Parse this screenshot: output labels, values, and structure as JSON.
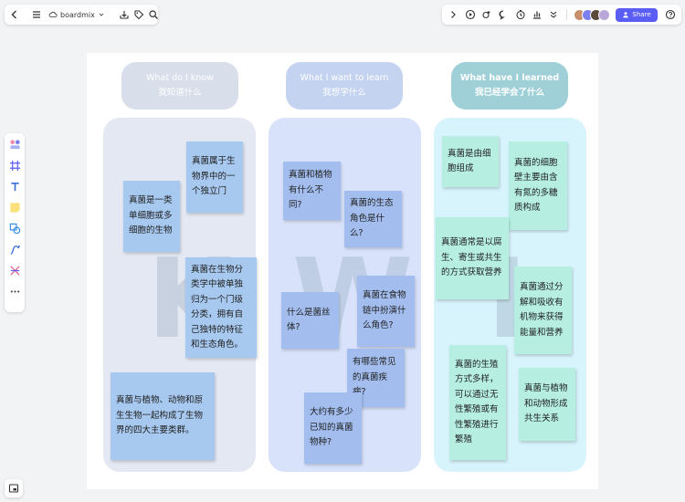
{
  "app": {
    "file_name": "boardmix",
    "share_label": "Share"
  },
  "icons": {
    "top_left": [
      "back-icon",
      "menu-icon",
      "cloud-icon",
      "chevron-down-icon",
      "download-icon",
      "tag-icon",
      "search-icon"
    ],
    "top_right": [
      "chevron-right-icon",
      "play-icon",
      "collaborate-icon",
      "comment-icon",
      "timer-icon",
      "chart-icon",
      "more-down-icon",
      "help-icon"
    ],
    "left_tools": [
      "template-icon",
      "frame-icon",
      "text-icon",
      "sticky-note-icon",
      "shape-icon",
      "pen-icon",
      "connector-icon",
      "more-icon"
    ]
  },
  "colors": {
    "accent": "#5b5ef4",
    "k_column": "#e3e8f3",
    "w_column": "#d8e3fb",
    "l_column": "#d7f3fb",
    "k_sticky": "#a7c8ef",
    "w_sticky": "#a2bdee",
    "l_sticky": "#b6efe2"
  },
  "columns": {
    "k": {
      "header_en": "What do I know",
      "header_zh": "我知道什么",
      "letter": "K",
      "notes": [
        "真菌属于生物界中的一个独立门",
        "真菌是一类单细胞或多细胞的生物",
        "真菌在生物分类学中被单独归为一个门级分类，拥有自己独特的特征和生态角色。",
        "真菌与植物、动物和原生生物一起构成了生物界的四大主要类群。"
      ]
    },
    "w": {
      "header_en": "What I want to learn",
      "header_zh": "我想学什么",
      "letter": "W",
      "notes": [
        "真菌和植物有什么不同?",
        "真菌的生态角色是什么?",
        "真菌在食物链中扮演什么角色?",
        "什么是菌丝体?",
        "有哪些常见的真菌疾病?",
        "大约有多少已知的真菌物种?"
      ]
    },
    "l": {
      "header_en": "What have I learned",
      "header_zh": "我已经学会了什么",
      "letter": "L",
      "notes": [
        "真菌是由细胞组成",
        "真菌的细胞壁主要由含有氮的多糖质构成",
        "真菌通常是以腐生、寄生或共生的方式获取营养",
        "真菌通过分解和吸收有机物来获得能量和营养",
        "真菌的生殖方式多样，可以通过无性繁殖或有性繁殖进行繁殖",
        "真菌与植物和动物形成共生关系"
      ]
    }
  }
}
